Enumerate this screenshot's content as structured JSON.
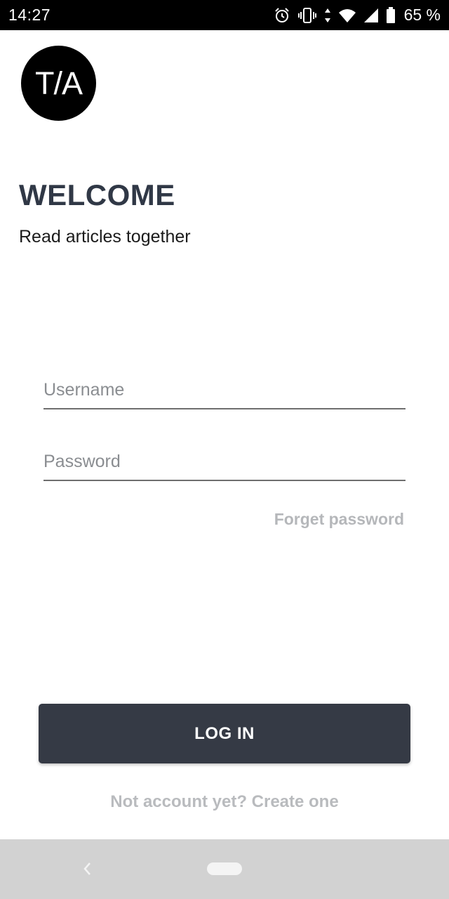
{
  "status_bar": {
    "time": "14:27",
    "battery_text": "65 %",
    "icons": [
      "alarm-icon",
      "vibrate-icon",
      "data-arrows-icon",
      "wifi-icon",
      "signal-icon",
      "battery-icon"
    ]
  },
  "logo": {
    "text": "T/A"
  },
  "welcome": {
    "title": "WELCOME",
    "subtitle": "Read articles together"
  },
  "form": {
    "username_placeholder": "Username",
    "username_value": "",
    "password_placeholder": "Password",
    "password_value": "",
    "forget_password": "Forget password",
    "login_label": "LOG IN",
    "signup_text": "Not account yet? Create one"
  },
  "navigation": {
    "icons": [
      "back-icon",
      "home-pill-icon"
    ]
  },
  "colors": {
    "title": "#303846",
    "button": "#353a45",
    "link_muted": "#b5b7ba",
    "nav_bar": "#d2d2d2"
  }
}
